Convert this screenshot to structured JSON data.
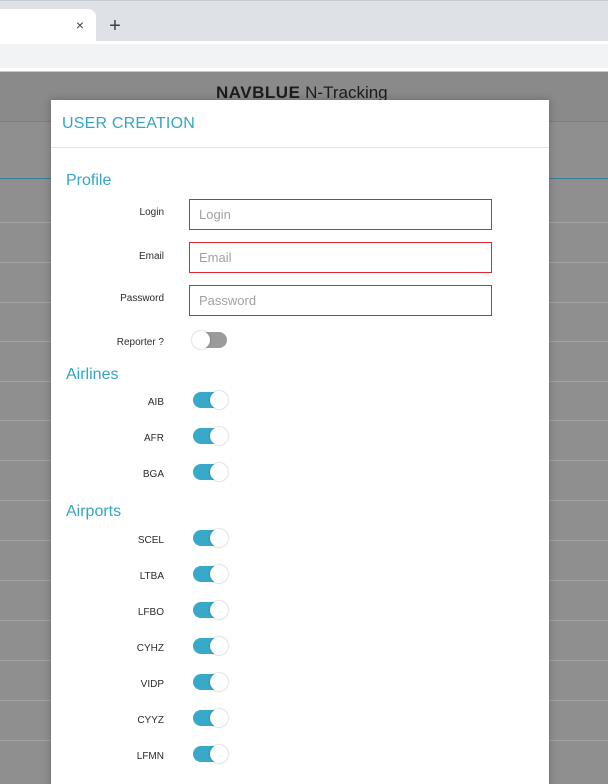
{
  "browser": {
    "close_tab_glyph": "×",
    "new_tab_glyph": "+"
  },
  "background": {
    "brand_bold": "NAVBLUE",
    "brand_rest": " N-Tracking"
  },
  "modal": {
    "title": "USER CREATION",
    "profile": {
      "title": "Profile",
      "login_label": "Login",
      "login_placeholder": "Login",
      "email_label": "Email",
      "email_placeholder": "Email",
      "password_label": "Password",
      "password_placeholder": "Password",
      "reporter_label": "Reporter ?",
      "reporter_on": false
    },
    "airlines": {
      "title": "Airlines",
      "items": [
        {
          "code": "AIB",
          "enabled": true
        },
        {
          "code": "AFR",
          "enabled": true
        },
        {
          "code": "BGA",
          "enabled": true
        }
      ]
    },
    "airports": {
      "title": "Airports",
      "items": [
        {
          "code": "SCEL",
          "enabled": true
        },
        {
          "code": "LTBA",
          "enabled": true
        },
        {
          "code": "LFBO",
          "enabled": true
        },
        {
          "code": "CYHZ",
          "enabled": true
        },
        {
          "code": "VIDP",
          "enabled": true
        },
        {
          "code": "CYYZ",
          "enabled": true
        },
        {
          "code": "LFMN",
          "enabled": true
        }
      ]
    }
  },
  "colors": {
    "accent": "#36a4c4",
    "toggle_on": "#38a9c9",
    "toggle_off": "#9b9b9b",
    "error_border": "#e0232f"
  }
}
